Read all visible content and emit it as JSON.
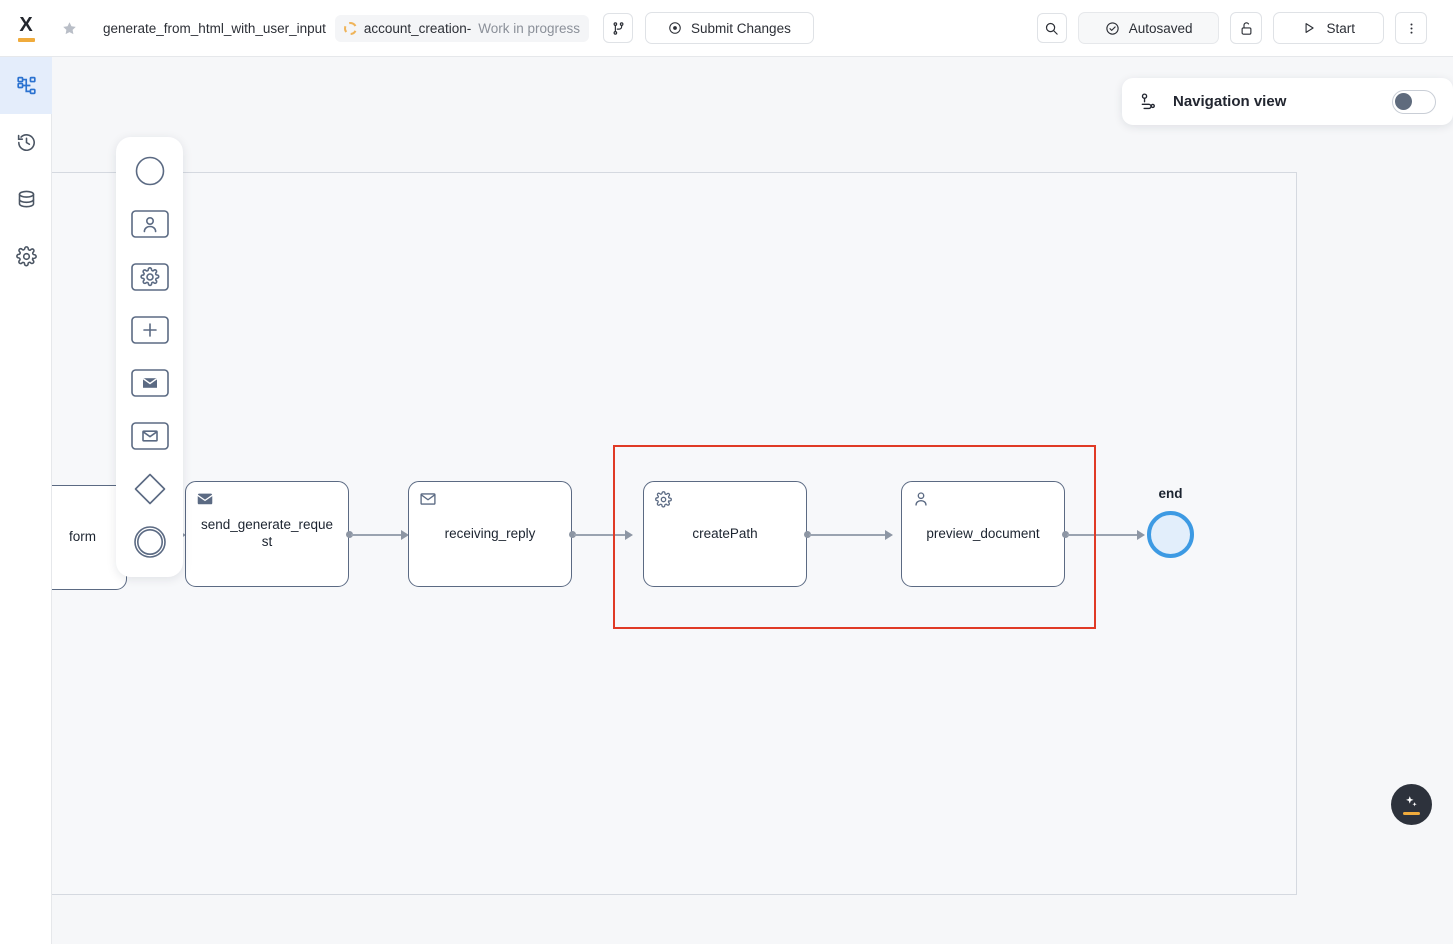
{
  "app": {
    "logo_letter": "X",
    "logo_name": "x-logo"
  },
  "topbar": {
    "favorite_icon": "star-icon",
    "process_title": "generate_from_html_with_user_input",
    "branch": {
      "spinner_icon": "loading-spinner-icon",
      "name": "account_creation-",
      "status": "Work in progress"
    },
    "branch_icon": "git-branch-icon",
    "submit": {
      "icon": "target-icon",
      "label": "Submit Changes"
    },
    "search_icon": "search-icon",
    "autosaved": {
      "icon": "check-circle-icon",
      "label": "Autosaved"
    },
    "lock_icon": "unlock-icon",
    "start": {
      "icon": "play-icon",
      "label": "Start"
    },
    "more_icon": "kebab-menu-icon"
  },
  "sidebar": {
    "items": [
      {
        "icon": "diagram-icon",
        "name": "sidebar-item-diagram",
        "active": true
      },
      {
        "icon": "history-icon",
        "name": "sidebar-item-history",
        "active": false
      },
      {
        "icon": "database-icon",
        "name": "sidebar-item-data",
        "active": false
      },
      {
        "icon": "gear-icon",
        "name": "sidebar-item-settings",
        "active": false
      }
    ]
  },
  "palette": {
    "items": [
      {
        "icon": "start-event-icon",
        "name": "palette-start-event"
      },
      {
        "icon": "user-task-icon",
        "name": "palette-user-task"
      },
      {
        "icon": "service-task-icon",
        "name": "palette-service-task"
      },
      {
        "icon": "plus-task-icon",
        "name": "palette-add-task"
      },
      {
        "icon": "send-task-icon",
        "name": "palette-send-task"
      },
      {
        "icon": "receive-task-icon",
        "name": "palette-receive-task"
      },
      {
        "icon": "gateway-icon",
        "name": "palette-gateway"
      },
      {
        "icon": "end-event-icon",
        "name": "palette-end-event"
      }
    ]
  },
  "navigation_panel": {
    "icon": "route-icon",
    "label": "Navigation view",
    "toggle_on": false
  },
  "canvas": {
    "nodes": [
      {
        "id": "form_node",
        "label": "form",
        "icon": null,
        "type": "task-clipped"
      },
      {
        "id": "send_request",
        "label": "send_generate_request",
        "icon": "send-task-icon",
        "type": "send-task"
      },
      {
        "id": "receiving_reply",
        "label": "receiving_reply",
        "icon": "receive-task-icon",
        "type": "receive-task"
      },
      {
        "id": "create_path",
        "label": "createPath",
        "icon": "service-task-icon",
        "type": "service-task"
      },
      {
        "id": "preview_document",
        "label": "preview_document",
        "icon": "user-task-icon",
        "type": "user-task"
      }
    ],
    "end_event": {
      "label": "end",
      "color": "#3d9ae3",
      "fill": "#e2eefb"
    },
    "selection": {
      "color": "#e03a25",
      "contains": [
        "createPath",
        "preview_document"
      ]
    }
  },
  "fab": {
    "icon": "sparkle-icon",
    "accent": "#f0ab3c"
  }
}
